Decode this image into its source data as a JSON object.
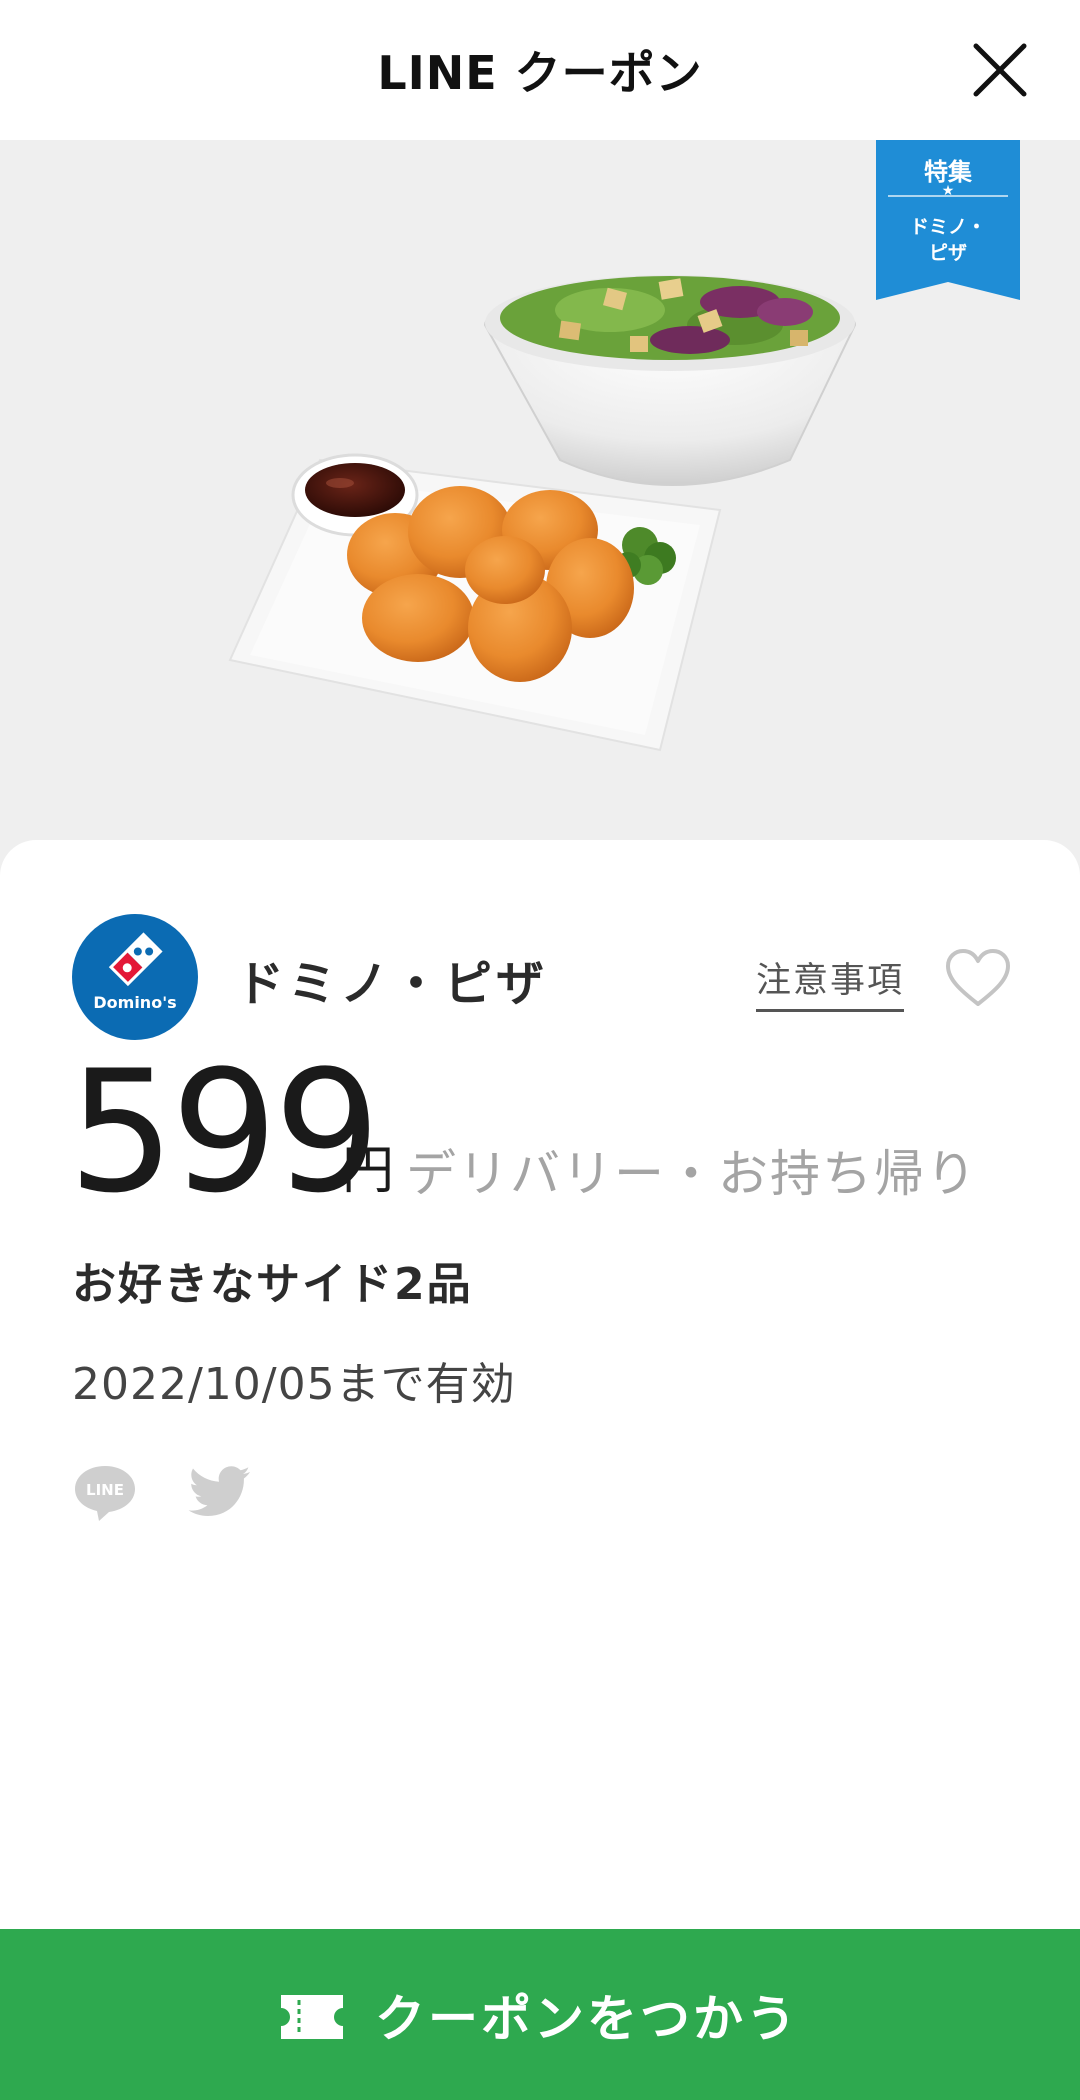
{
  "header": {
    "title": "LINE クーポン",
    "close_icon": "close-icon"
  },
  "hero": {
    "ribbon": {
      "line1": "特集",
      "star": "★",
      "line2": "ドミノ・",
      "line3": "ピザ",
      "color": "#1f8dd6"
    }
  },
  "coupon": {
    "brand": {
      "name": "ドミノ・ピザ",
      "logo_text": "Domino's",
      "logo_color": "#0b6bb3"
    },
    "notes_label": "注意事項",
    "favorite_icon": "heart-outline-icon",
    "price": {
      "value": "599",
      "unit": "円",
      "note": "デリバリー・お持ち帰り"
    },
    "item_title": "お好きなサイド2品",
    "validity": "2022/10/05まで有効",
    "share": {
      "line_label": "LINE",
      "line_icon": "line-share-icon",
      "twitter_icon": "twitter-icon"
    }
  },
  "cta": {
    "label": "クーポンをつかう",
    "icon": "ticket-icon",
    "color": "#2ea94f"
  }
}
